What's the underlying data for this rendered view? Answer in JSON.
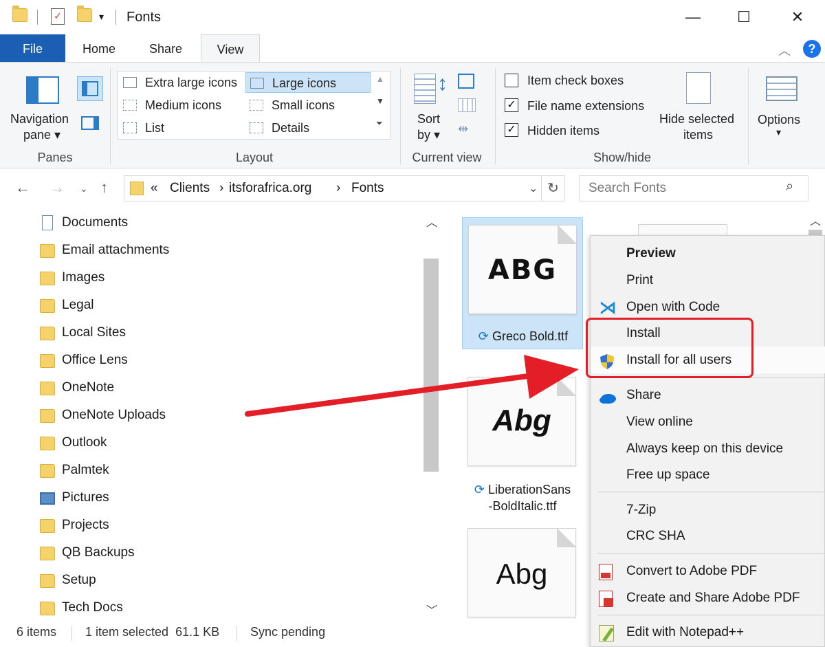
{
  "window": {
    "title": "Fonts",
    "minimize_glyph": "—",
    "maximize_glyph": "☐",
    "close_glyph": "✕"
  },
  "ribbon_tabs": [
    "File",
    "Home",
    "Share",
    "View"
  ],
  "ribbon": {
    "panes": {
      "nav_pane_line1": "Navigation",
      "nav_pane_line2": "pane ▾",
      "label": "Panes"
    },
    "layout": {
      "items": [
        "Extra large icons",
        "Large icons",
        "Medium icons",
        "Small icons",
        "List",
        "Details"
      ],
      "selected": "Large icons",
      "label": "Layout"
    },
    "current_view": {
      "sort_line1": "Sort",
      "sort_line2": "by ▾",
      "label": "Current view"
    },
    "show_hide": {
      "item_check_boxes": "Item check boxes",
      "file_name_extensions": "File name extensions",
      "hidden_items": "Hidden items",
      "item_check_boxes_checked": false,
      "file_name_extensions_checked": true,
      "hidden_items_checked": true,
      "hide_selected_line1": "Hide selected",
      "hide_selected_line2": "items",
      "label": "Show/hide"
    },
    "options": {
      "label": "Options",
      "caret": "▾"
    }
  },
  "address": {
    "prefix": "«",
    "crumbs": [
      "Clients",
      "itsforafrica.org",
      "Fonts"
    ],
    "separator": "›",
    "search_placeholder": "Search Fonts"
  },
  "nav_tree": [
    {
      "label": "Documents",
      "icon": "document-folder-icon"
    },
    {
      "label": "Email attachments",
      "icon": "folder-icon"
    },
    {
      "label": "Images",
      "icon": "folder-icon"
    },
    {
      "label": "Legal",
      "icon": "folder-icon"
    },
    {
      "label": "Local Sites",
      "icon": "folder-icon"
    },
    {
      "label": "Office Lens",
      "icon": "folder-icon"
    },
    {
      "label": "OneNote",
      "icon": "folder-icon"
    },
    {
      "label": "OneNote Uploads",
      "icon": "folder-icon"
    },
    {
      "label": "Outlook",
      "icon": "folder-icon"
    },
    {
      "label": "Palmtek",
      "icon": "folder-icon"
    },
    {
      "label": "Pictures",
      "icon": "pictures-folder-icon"
    },
    {
      "label": "Projects",
      "icon": "folder-icon"
    },
    {
      "label": "QB Backups",
      "icon": "folder-icon"
    },
    {
      "label": "Setup",
      "icon": "folder-icon"
    },
    {
      "label": "Tech Docs",
      "icon": "folder-icon"
    }
  ],
  "files": [
    {
      "sample": "ABG",
      "name_line1": "Greco Bold.ttf",
      "name_line2": "",
      "selected": true
    },
    {
      "sample": "Abg",
      "name_line1": "LiberationSans",
      "name_line2": "-BoldItalic.ttf",
      "selected": false
    },
    {
      "sample": "Abg",
      "name_line1": "",
      "name_line2": "",
      "selected": false
    }
  ],
  "context_menu": {
    "preview": "Preview",
    "print": "Print",
    "open_with_code": "Open with Code",
    "install": "Install",
    "install_all_users": "Install for all users",
    "share": "Share",
    "view_online": "View online",
    "always_keep": "Always keep on this device",
    "free_up_space": "Free up space",
    "seven_zip": "7-Zip",
    "crc_sha": "CRC SHA",
    "convert_pdf": "Convert to Adobe PDF",
    "create_share_pdf": "Create and Share Adobe PDF",
    "edit_notepad": "Edit with Notepad++"
  },
  "status": {
    "items": "6 items",
    "selected": "1 item selected  61.1 KB",
    "sync": "Sync pending"
  },
  "colors": {
    "accent": "#1a5fb4",
    "selection": "#cce4f7",
    "annotation_red": "#e41e26",
    "folder": "#f6d26b"
  }
}
